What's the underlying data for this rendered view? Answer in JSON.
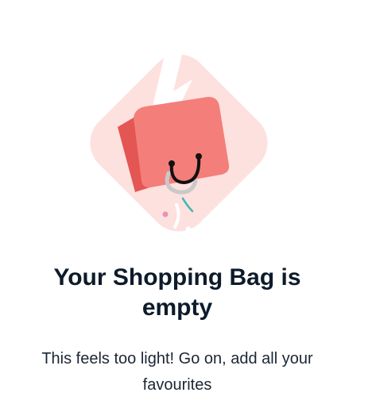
{
  "empty_state": {
    "title_line1": "Your Shopping Bag is",
    "title_line2": "empty",
    "message_line1": "This feels too light! Go on, add all your",
    "message_line2": "favourites"
  },
  "illustration": {
    "icon": "torn-shopping-bag-icon",
    "colors": {
      "background_diamond": "#fde1de",
      "bag_front": "#f47e7a",
      "bag_side": "#e45653",
      "handle": "#111111",
      "accent_teal": "#3fb6b0",
      "accent_pink": "#ee8fb5"
    }
  }
}
